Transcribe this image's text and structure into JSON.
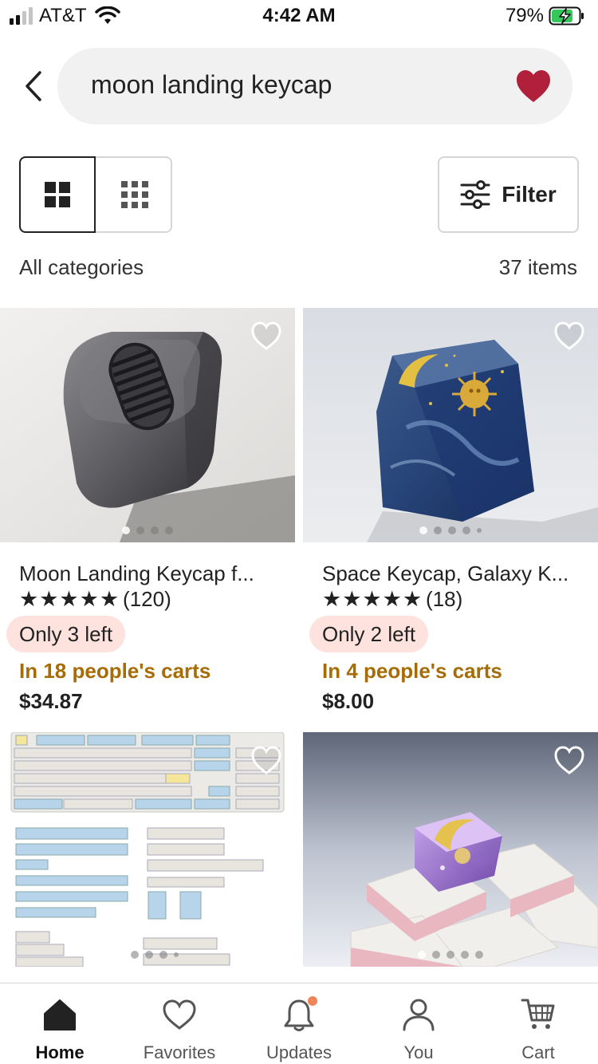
{
  "status_bar": {
    "carrier": "AT&T",
    "time": "4:42 AM",
    "battery": "79%"
  },
  "search": {
    "query": "moon landing keycap"
  },
  "toolbar": {
    "filter_label": "Filter"
  },
  "results": {
    "category": "All categories",
    "count": "37 items"
  },
  "products": [
    {
      "title": "Moon Landing Keycap f...",
      "stars": "★★★★★",
      "reviews": "(120)",
      "stock": "Only 3 left",
      "carts": "In 18 people's carts",
      "price": "$34.87"
    },
    {
      "title": "Space Keycap, Galaxy K...",
      "stars": "★★★★★",
      "reviews": "(18)",
      "stock": "Only 2 left",
      "carts": "In 4 people's carts",
      "price": "$8.00"
    },
    {},
    {}
  ],
  "nav": [
    {
      "label": "Home",
      "icon": "home-icon"
    },
    {
      "label": "Favorites",
      "icon": "heart-icon"
    },
    {
      "label": "Updates",
      "icon": "bell-icon"
    },
    {
      "label": "You",
      "icon": "person-icon"
    },
    {
      "label": "Cart",
      "icon": "cart-icon"
    }
  ],
  "colors": {
    "accent_heart": "#b0203a",
    "carts_text": "#a66c06",
    "stock_badge_bg": "#fde2de",
    "update_dot": "#f0855a"
  }
}
